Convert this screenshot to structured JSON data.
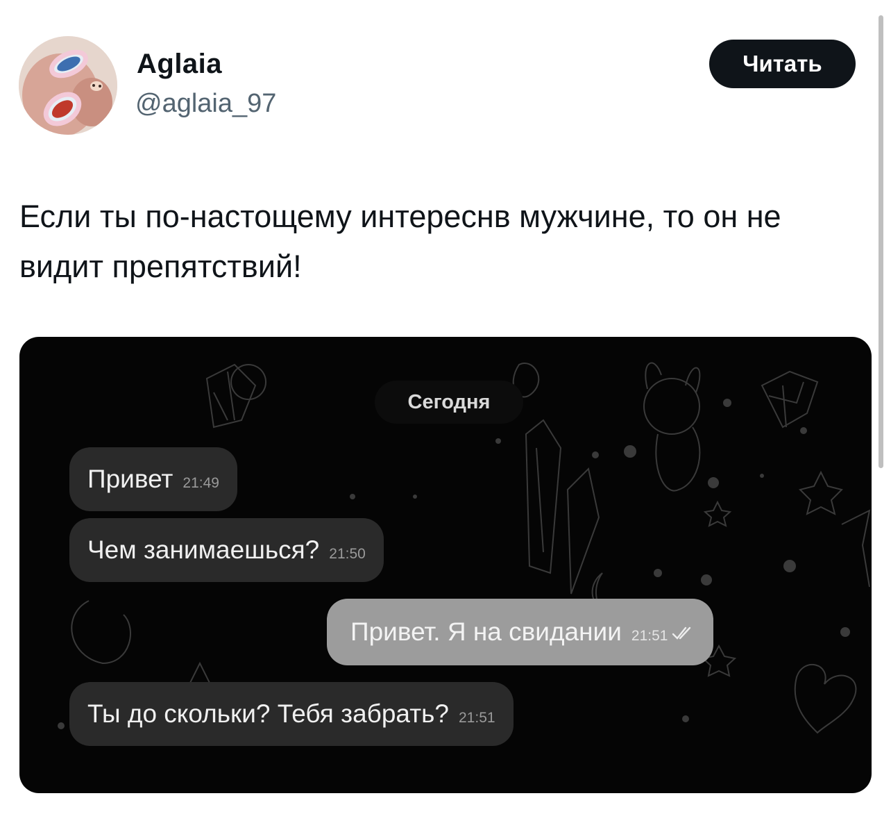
{
  "author": {
    "display_name": "Aglaia",
    "handle": "@aglaia_97"
  },
  "follow_button": "Читать",
  "tweet_text": "Если ты по-настощему интереснв мужчине, то он не видит препятствий!",
  "chat": {
    "date_label": "Сегодня",
    "messages": [
      {
        "text": "Привет",
        "time": "21:49",
        "direction": "incoming"
      },
      {
        "text": "Чем занимаешься?",
        "time": "21:50",
        "direction": "incoming"
      },
      {
        "text": "Привет. Я на свидании",
        "time": "21:51",
        "direction": "outgoing",
        "status_icon": "double-check-icon"
      },
      {
        "text": "Ты до скольки? Тебя забрать?",
        "time": "21:51",
        "direction": "incoming"
      }
    ]
  },
  "colors": {
    "follow_button_bg": "#0f1419",
    "handle_text": "#536471",
    "chat_background": "#050505",
    "incoming_bubble": "#2a2a2a",
    "outgoing_bubble": "#9c9c9c"
  }
}
